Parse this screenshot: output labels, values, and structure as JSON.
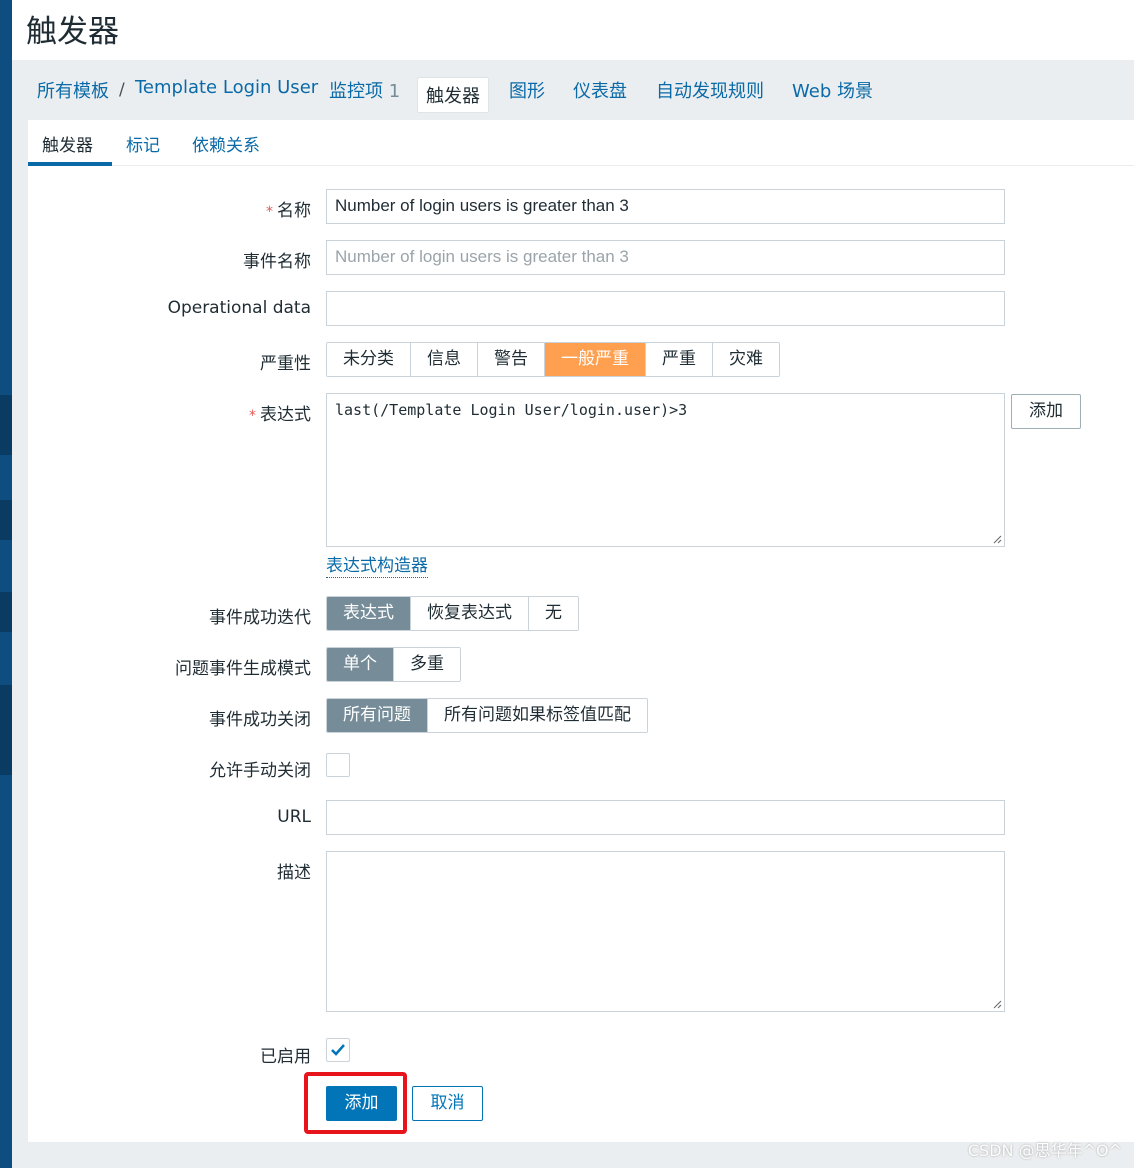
{
  "page": {
    "title": "触发器"
  },
  "breadcrumb": {
    "all_templates": "所有模板",
    "separator": "/",
    "template_name": "Template Login User",
    "items": {
      "label": "监控项",
      "count": "1"
    },
    "triggers": "触发器",
    "graphs": "图形",
    "dashboards": "仪表盘",
    "discovery": "自动发现规则",
    "web": "Web 场景"
  },
  "tabs": {
    "trigger": "触发器",
    "tags": "标记",
    "dependencies": "依赖关系"
  },
  "form": {
    "required_mark": "*",
    "name": {
      "label": "名称",
      "value": "Number of login users is greater than 3"
    },
    "event_name": {
      "label": "事件名称",
      "placeholder": "Number of login users is greater than 3"
    },
    "operational_data": {
      "label": "Operational data",
      "value": ""
    },
    "severity": {
      "label": "严重性",
      "options": [
        "未分类",
        "信息",
        "警告",
        "一般严重",
        "严重",
        "灾难"
      ],
      "selected": "一般严重"
    },
    "expression": {
      "label": "表达式",
      "value": "last(/Template Login User/login.user)>3",
      "add_button": "添加",
      "builder_link": "表达式构造器"
    },
    "ok_event_generation": {
      "label": "事件成功迭代",
      "options": [
        "表达式",
        "恢复表达式",
        "无"
      ],
      "selected": "表达式"
    },
    "problem_event_mode": {
      "label": "问题事件生成模式",
      "options": [
        "单个",
        "多重"
      ],
      "selected": "单个"
    },
    "ok_event_closes": {
      "label": "事件成功关闭",
      "options": [
        "所有问题",
        "所有问题如果标签值匹配"
      ],
      "selected": "所有问题"
    },
    "allow_manual_close": {
      "label": "允许手动关闭",
      "checked": false
    },
    "url": {
      "label": "URL",
      "value": ""
    },
    "description": {
      "label": "描述",
      "value": ""
    },
    "enabled": {
      "label": "已启用",
      "checked": true
    }
  },
  "actions": {
    "add": "添加",
    "cancel": "取消"
  },
  "watermark": "CSDN @思华年^O^",
  "colors": {
    "accent": "#0275b8",
    "severity_selected": "#ff9f50",
    "segment_selected": "#768d99",
    "highlight": "#e8141c"
  }
}
